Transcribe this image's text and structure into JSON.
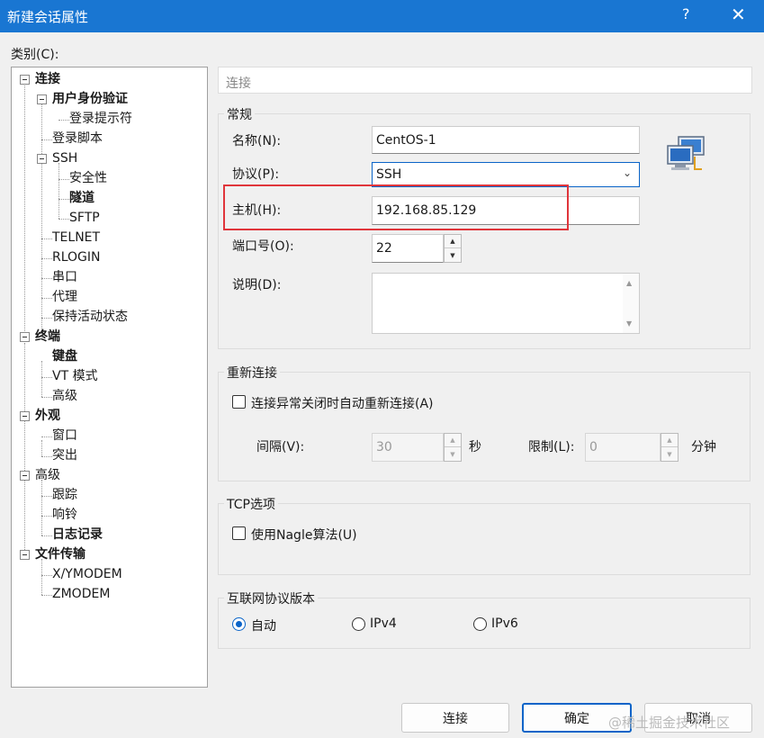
{
  "window": {
    "title": "新建会话属性",
    "help": "?",
    "close": "✕"
  },
  "category_label": "类别(C):",
  "tree": [
    {
      "label": "连接",
      "bold": true
    },
    {
      "label": "用户身份验证",
      "bold": true
    },
    {
      "label": "登录提示符",
      "bold": false
    },
    {
      "label": "登录脚本",
      "bold": false
    },
    {
      "label": "SSH",
      "bold": false
    },
    {
      "label": "安全性",
      "bold": false
    },
    {
      "label": "隧道",
      "bold": true
    },
    {
      "label": "SFTP",
      "bold": false
    },
    {
      "label": "TELNET",
      "bold": false
    },
    {
      "label": "RLOGIN",
      "bold": false
    },
    {
      "label": "串口",
      "bold": false
    },
    {
      "label": "代理",
      "bold": false
    },
    {
      "label": "保持活动状态",
      "bold": false
    },
    {
      "label": "终端",
      "bold": true
    },
    {
      "label": "键盘",
      "bold": true
    },
    {
      "label": "VT 模式",
      "bold": false
    },
    {
      "label": "高级",
      "bold": false
    },
    {
      "label": "外观",
      "bold": true
    },
    {
      "label": "窗口",
      "bold": false
    },
    {
      "label": "突出",
      "bold": false
    },
    {
      "label": "高级",
      "bold": false
    },
    {
      "label": "跟踪",
      "bold": false
    },
    {
      "label": "响铃",
      "bold": false
    },
    {
      "label": "日志记录",
      "bold": true
    },
    {
      "label": "文件传输",
      "bold": true
    },
    {
      "label": "X/YMODEM",
      "bold": false
    },
    {
      "label": "ZMODEM",
      "bold": false
    }
  ],
  "panel_header": "连接",
  "general": {
    "title": "常规",
    "name_label": "名称(N):",
    "name_value": "CentOS-1",
    "protocol_label": "协议(P):",
    "protocol_value": "SSH",
    "host_label": "主机(H):",
    "host_value": "192.168.85.129",
    "port_label": "端口号(O):",
    "port_value": "22",
    "desc_label": "说明(D):"
  },
  "reconnect": {
    "title": "重新连接",
    "checkbox_label": "连接异常关闭时自动重新连接(A)",
    "interval_label": "间隔(V):",
    "interval_value": "30",
    "interval_unit": "秒",
    "limit_label": "限制(L):",
    "limit_value": "0",
    "limit_unit": "分钟"
  },
  "tcp": {
    "title": "TCP选项",
    "nagle_label": "使用Nagle算法(U)"
  },
  "ipver": {
    "title": "互联网协议版本",
    "auto": "自动",
    "ipv4": "IPv4",
    "ipv6": "IPv6"
  },
  "buttons": {
    "connect": "连接",
    "ok": "确定",
    "cancel": "取消"
  },
  "watermark": "@稀土掘金技术社区"
}
